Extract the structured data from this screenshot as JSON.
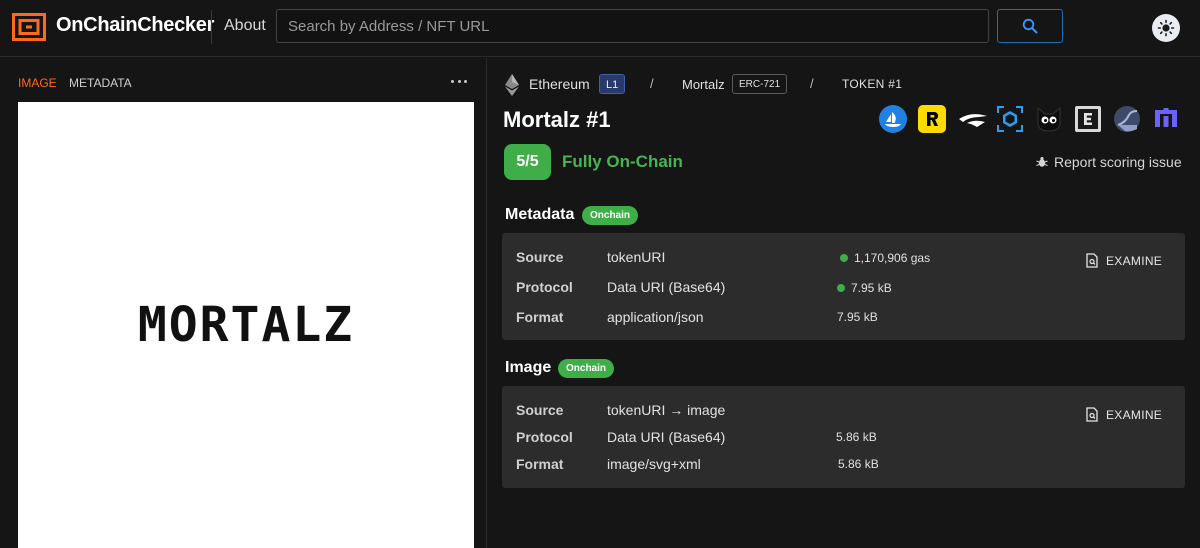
{
  "header": {
    "brand": "OnChainChecker",
    "nav_about": "About",
    "search_placeholder": "Search by Address / NFT URL",
    "search_icon": "search-icon",
    "theme_icon": "sun-icon",
    "brand_color": "#ff6a1a"
  },
  "left_panel": {
    "tabs": [
      {
        "label": "IMAGE",
        "active": true
      },
      {
        "label": "METADATA",
        "active": false
      }
    ],
    "more_icon": "more-horizontal-icon",
    "nft_image_text": "MORTALZ"
  },
  "breadcrumb": {
    "chain_icon": "ethereum-icon",
    "chain": "Ethereum",
    "chain_tag": "L1",
    "separator": "/",
    "collection": "Mortalz",
    "standard": "ERC-721",
    "token": "TOKEN #1"
  },
  "token": {
    "title": "Mortalz #1",
    "marketplaces": [
      "opensea-icon",
      "rarible-icon",
      "looksrare-icon",
      "blur-icon",
      "element-cat-icon",
      "etherscan-e-icon",
      "chart-icon",
      "mintify-icon"
    ],
    "score": "5/5",
    "status": "Fully On-Chain",
    "status_color": "#47b551",
    "report_icon": "bug-icon",
    "report_label": "Report scoring issue"
  },
  "metadata": {
    "title": "Metadata",
    "badge": "Onchain",
    "examine_label": "EXAMINE",
    "rows": [
      {
        "label": "Source",
        "value": "tokenURI",
        "metric": "1,170,906 gas",
        "dot": true
      },
      {
        "label": "Protocol",
        "value": "Data URI (Base64)",
        "metric": "7.95 kB",
        "dot": true
      },
      {
        "label": "Format",
        "value": "application/json",
        "metric": "7.95 kB",
        "dot": false
      }
    ]
  },
  "image": {
    "title": "Image",
    "badge": "Onchain",
    "examine_label": "EXAMINE",
    "rows": [
      {
        "label": "Source",
        "value": "tokenURI → image",
        "metric": "",
        "dot": false
      },
      {
        "label": "Protocol",
        "value": "Data URI (Base64)",
        "metric": "5.86 kB",
        "dot": false
      },
      {
        "label": "Format",
        "value": "image/svg+xml",
        "metric": "5.86 kB",
        "dot": false
      }
    ]
  }
}
